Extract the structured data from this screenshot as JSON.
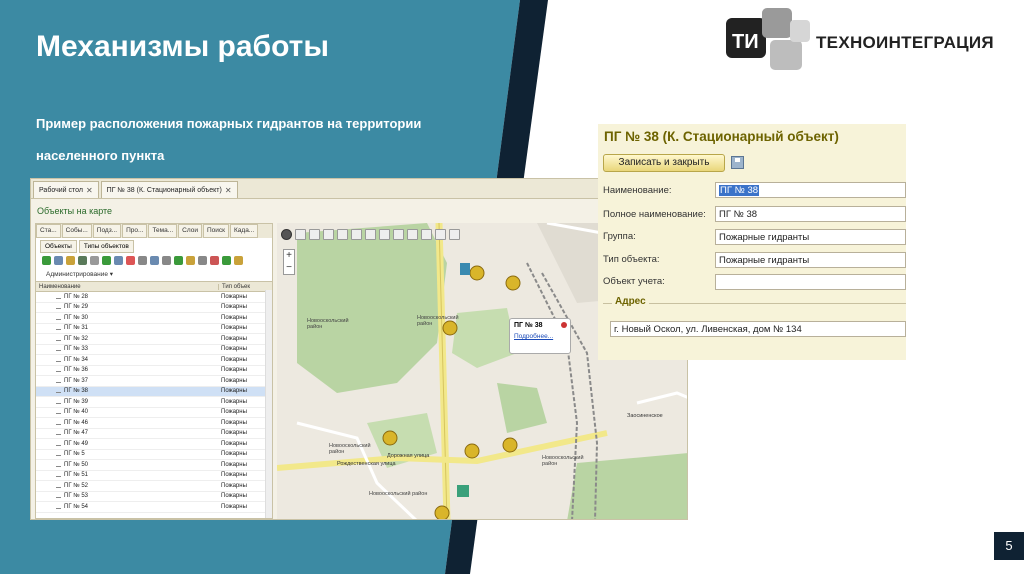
{
  "slide": {
    "title": "Механизмы работы",
    "subtitle": "Пример расположения пожарных гидрантов на территории населенного пункта",
    "page_number": "5",
    "colors": {
      "teal": "#3c8aa3",
      "navy": "#0f2233",
      "accent": "#6d6300"
    }
  },
  "logo": {
    "text": "ТЕХНОИНТЕГРАЦИЯ",
    "mark": "ТИ"
  },
  "app": {
    "tabs": [
      {
        "label": "Рабочий стол",
        "close": "✕"
      },
      {
        "label": "ПГ № 38 (К. Стационарный объект)",
        "close": "✕"
      }
    ],
    "panel_title": "Объекты на карте",
    "left_tabs": [
      "Ста...",
      "Собы...",
      "Подз...",
      "Про...",
      "Тема...",
      "Слои",
      "Поиск",
      "Када..."
    ],
    "sub_tabs": [
      "Объекты",
      "Типы объектов"
    ],
    "admin_label": "Администрирование ▾",
    "grid_headers": [
      "Наименование",
      "Тип объек"
    ],
    "rows": [
      {
        "name": "ПГ № 28",
        "type": "Пожарны"
      },
      {
        "name": "ПГ № 29",
        "type": "Пожарны"
      },
      {
        "name": "ПГ № 30",
        "type": "Пожарны"
      },
      {
        "name": "ПГ № 31",
        "type": "Пожарны"
      },
      {
        "name": "ПГ № 32",
        "type": "Пожарны"
      },
      {
        "name": "ПГ № 33",
        "type": "Пожарны"
      },
      {
        "name": "ПГ № 34",
        "type": "Пожарны"
      },
      {
        "name": "ПГ № 36",
        "type": "Пожарны"
      },
      {
        "name": "ПГ № 37",
        "type": "Пожарны"
      },
      {
        "name": "ПГ № 38",
        "type": "Пожарны",
        "selected": true
      },
      {
        "name": "ПГ № 39",
        "type": "Пожарны"
      },
      {
        "name": "ПГ № 40",
        "type": "Пожарны"
      },
      {
        "name": "ПГ № 46",
        "type": "Пожарны"
      },
      {
        "name": "ПГ № 47",
        "type": "Пожарны"
      },
      {
        "name": "ПГ № 49",
        "type": "Пожарны"
      },
      {
        "name": "ПГ № 5",
        "type": "Пожарны"
      },
      {
        "name": "ПГ № 50",
        "type": "Пожарны"
      },
      {
        "name": "ПГ № 51",
        "type": "Пожарны"
      },
      {
        "name": "ПГ № 52",
        "type": "Пожарны"
      },
      {
        "name": "ПГ № 53",
        "type": "Пожарны"
      },
      {
        "name": "ПГ № 54",
        "type": "Пожарны"
      }
    ],
    "map": {
      "popup_title": "ПГ № 38",
      "popup_link": "Подробнее...",
      "labels": [
        "Новооскольский район",
        "Новооскольский район",
        "Новооскольский район",
        "Новооскольский район",
        "Новооскольский район"
      ],
      "streets": [
        "Рождественская улица",
        "Дорожная улица",
        "Заосиненское"
      ],
      "zoom_in": "+",
      "zoom_out": "−"
    }
  },
  "form": {
    "title": "ПГ № 38 (К. Стационарный объект)",
    "save_button": "Записать и закрыть",
    "fields": [
      {
        "label": "Наименование:",
        "value": "ПГ № 38"
      },
      {
        "label": "Полное наименование:",
        "value": "ПГ № 38"
      },
      {
        "label": "Группа:",
        "value": "Пожарные гидранты"
      },
      {
        "label": "Тип объекта:",
        "value": "Пожарные гидранты"
      },
      {
        "label": "Объект учета:",
        "value": ""
      }
    ],
    "address_legend": "Адрес",
    "address_value": "г. Новый Оскол, ул. Ливенская, дом № 134"
  }
}
